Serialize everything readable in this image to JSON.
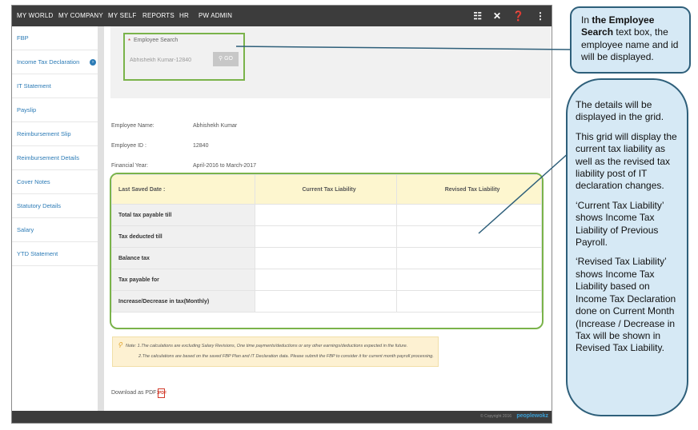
{
  "topnav": {
    "items": [
      "MY WORLD",
      "MY COMPANY",
      "MY SELF",
      "REPORTS",
      "HR",
      "PW ADMIN"
    ],
    "icons": [
      "book-icon",
      "tools-icon",
      "help-icon",
      "share-icon"
    ]
  },
  "sidebar": {
    "items": [
      "FBP",
      "Income Tax Declaration",
      "IT Statement",
      "Payslip",
      "Reimbursement Slip",
      "Reimbursement Details",
      "Cover Notes",
      "Statutory Details",
      "Salary",
      "YTD Statement"
    ],
    "active_index": 1
  },
  "search": {
    "label": "Employee Search",
    "value": "Abhishekh Kumar-12840",
    "go_label": "GO"
  },
  "employee": {
    "name_label": "Employee Name:",
    "name_value": "Abhishekh Kumar",
    "id_label": "Employee ID :",
    "id_value": "12840",
    "year_label": "Financial Year:",
    "year_value": "April-2016 to March-2017"
  },
  "grid": {
    "headers": [
      "Last Saved Date :",
      "Current Tax Liability",
      "Revised Tax Liability"
    ],
    "rows": [
      "Total tax payable till",
      "Tax deducted till",
      "Balance tax",
      "Tax payable for",
      "Increase/Decrease in tax(Monthly)"
    ]
  },
  "note": {
    "line1": "Note: 1.The calculations are excluding Salary Revisions, One time payments/deductions or any other earnings/deductions expected in the future.",
    "line2": "2.The calculations are based on the saved FBP Plan and IT Declaration data. Please submit the FBP to consider it for current month payroll processing."
  },
  "download_label": "Download as PDF:",
  "pdf_icon_text": "PDF",
  "footer": {
    "copyright": "© Copyright 2016",
    "brand": "peoplewokz"
  },
  "callouts": {
    "c1_pre": "In ",
    "c1_bold": "the Employee Search",
    "c1_post": " text box, the employee name and id will be displayed.",
    "c2_p1": "The details will be displayed in the grid.",
    "c2_p2": "This grid will display the current tax liability as well as the revised tax liability post of IT declaration changes.",
    "c2_p3": "‘Current Tax Liability’ shows Income Tax Liability of Previous Payroll.",
    "c2_p4": "‘Revised Tax Liability’ shows Income Tax Liability based on Income Tax Declaration done on Current Month (Increase / Decrease in Tax will be shown in Revised Tax Liability."
  },
  "colors": {
    "topbar": "#3c3c3c",
    "highlight_border": "#7ab34a",
    "link": "#2c7bb6",
    "callout_fill": "#d6e9f5",
    "callout_border": "#2e5f7a",
    "grid_header": "#fdf6cf"
  }
}
